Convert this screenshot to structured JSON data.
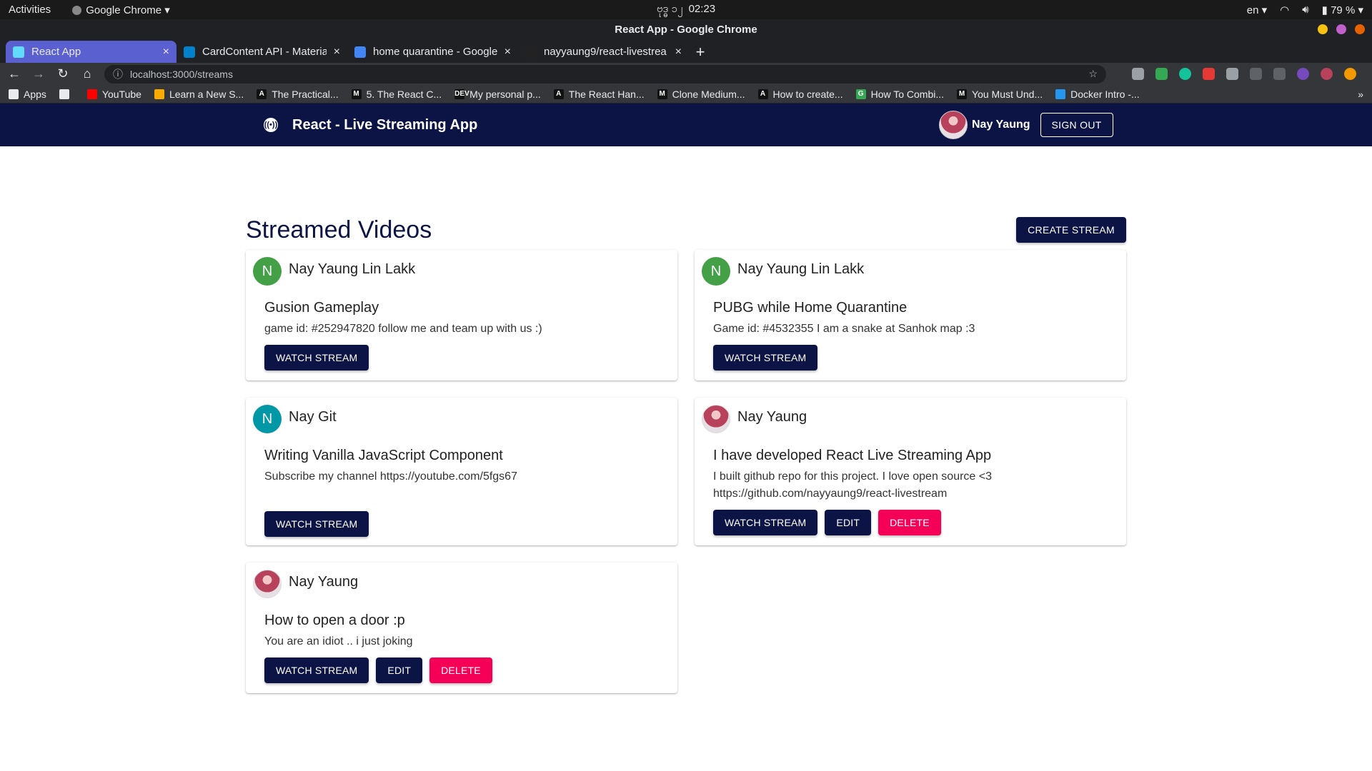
{
  "os": {
    "activities": "Activities",
    "app": "Google Chrome",
    "clock_prefix": "ဗုဒ္ဓ ၁၂",
    "clock": "02:23",
    "lang": "en",
    "battery": "79 %"
  },
  "window": {
    "title": "React App - Google Chrome"
  },
  "tabs": [
    {
      "label": "React App",
      "color": "#61dafb"
    },
    {
      "label": "CardContent API - Materia",
      "color": "#0081cb"
    },
    {
      "label": "home quarantine - Google",
      "color": "#4285f4"
    },
    {
      "label": "nayyaung9/react-livestrea",
      "color": "#222222"
    }
  ],
  "toolbar": {
    "url": "localhost:3000/streams"
  },
  "bookmarks": [
    {
      "label": "Apps",
      "icon": "apps-grid-icon"
    },
    {
      "label": "",
      "icon": "globe-icon"
    },
    {
      "label": "YouTube",
      "icon": "youtube-icon"
    },
    {
      "label": "Learn a New S...",
      "icon": "bookmark-icon"
    },
    {
      "label": "The Practical...",
      "icon": "A"
    },
    {
      "label": "5. The React C...",
      "icon": "M"
    },
    {
      "label": "My personal p...",
      "icon": "DEV"
    },
    {
      "label": "The React Han...",
      "icon": "A"
    },
    {
      "label": "Clone Medium...",
      "icon": "M"
    },
    {
      "label": "How to create...",
      "icon": "A"
    },
    {
      "label": "How To Combi...",
      "icon": "G"
    },
    {
      "label": "You Must Und...",
      "icon": "M"
    },
    {
      "label": "Docker Intro -...",
      "icon": "docker-icon"
    }
  ],
  "appbar": {
    "title": "React - Live Streaming App",
    "user": "Nay Yaung",
    "signout": "SIGN OUT"
  },
  "page": {
    "heading": "Streamed Videos",
    "create": "CREATE STREAM"
  },
  "streams": [
    {
      "author": "Nay Yaung Lin Lakk",
      "avatar_letter": "N",
      "avatar_color": "#43a047",
      "title": "Gusion Gameplay",
      "description": "game id: #252947820 follow me and team up with us :)",
      "watch": "WATCH STREAM",
      "edit": "",
      "delete": ""
    },
    {
      "author": "Nay Yaung Lin Lakk",
      "avatar_letter": "N",
      "avatar_color": "#43a047",
      "title": "PUBG while Home Quarantine",
      "description": "Game id: #4532355 I am a snake at Sanhok map :3",
      "watch": "WATCH STREAM",
      "edit": "",
      "delete": ""
    },
    {
      "author": "Nay Git",
      "avatar_letter": "N",
      "avatar_color": "#0097a7",
      "title": "Writing Vanilla JavaScript Component",
      "description": "Subscribe my channel https://youtube.com/5fgs67",
      "watch": "WATCH STREAM",
      "edit": "",
      "delete": ""
    },
    {
      "author": "Nay Yaung",
      "avatar_letter": "",
      "avatar_color": "",
      "title": "I have developed React Live Streaming App",
      "description": "I built github repo for this project. I love open source <3 https://github.com/nayyaung9/react-livestream",
      "watch": "WATCH STREAM",
      "edit": "EDIT",
      "delete": "DELETE"
    },
    {
      "author": "Nay Yaung",
      "avatar_letter": "",
      "avatar_color": "",
      "title": "How to open a door :p",
      "description": "You are an idiot .. i just joking",
      "watch": "WATCH STREAM",
      "edit": "EDIT",
      "delete": "DELETE"
    }
  ]
}
